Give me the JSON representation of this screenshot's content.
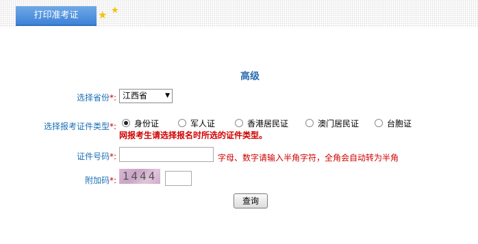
{
  "header": {
    "tab_label": "打印准考证"
  },
  "form": {
    "title": "高级",
    "required_mark": "*:",
    "province": {
      "label": "选择省份",
      "value": "江西省",
      "arrow": "▼"
    },
    "id_type": {
      "label": "选择报考证件类型",
      "options": [
        "身份证",
        "军人证",
        "香港居民证",
        "澳门居民证",
        "台胞证"
      ],
      "selected": "身份证",
      "warning": "网报考生请选择报名时所选的证件类型。"
    },
    "id_number": {
      "label": "证件号码",
      "value": "",
      "hint": "字母、数字请输入半角字符，全角会自动转为半角"
    },
    "captcha": {
      "label": "附加码",
      "image_text": "1444",
      "value": ""
    },
    "submit_label": "查询"
  },
  "icons": {
    "star": "★"
  },
  "colors": {
    "label": "#1a6fb8",
    "title": "#2b6cb0",
    "warning": "#d00000",
    "tab": "#3e83d8"
  }
}
